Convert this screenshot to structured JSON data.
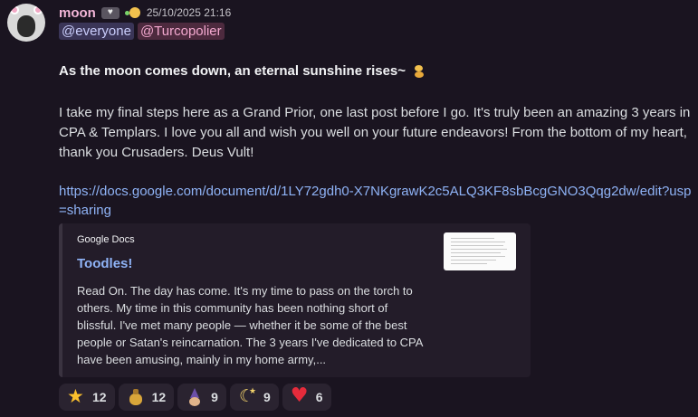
{
  "message": {
    "username": "moon",
    "timestamp": "25/10/2025 21:16",
    "mentions": [
      "@everyone",
      "@Turcopolier"
    ],
    "headline": "As the moon comes down, an eternal sunshine rises~",
    "body": "I take my final steps here as a Grand Prior, one last post before I go. It's truly been an amazing 3 years in CPA & Templars. I love you all and wish you well on your future endeavors! From the bottom of my heart, thank you Crusaders. Deus Vult!",
    "link": "https://docs.google.com/document/d/1LY72gdh0-X7NKgrawK2c5ALQ3KF8sbBcgGNO3Qqg2dw/edit?usp=sharing"
  },
  "embed": {
    "provider": "Google Docs",
    "title": "Toodles!",
    "description": "Read On. The day has come. It's my time to pass on the torch to others. My time in this community has been nothing short of blissful. I've met many people — whether it be some of the best people or Satan's reincarnation. The 3 years I've dedicated to CPA have been amusing, mainly in my home army,..."
  },
  "reactions": [
    {
      "icon": "star-icon",
      "count": "12"
    },
    {
      "icon": "moneybag-icon",
      "count": "12"
    },
    {
      "icon": "wizard-icon",
      "count": "9"
    },
    {
      "icon": "moon-icon",
      "count": "9"
    },
    {
      "icon": "heart-icon",
      "count": "6"
    }
  ],
  "colors": {
    "background": "#1a1420",
    "username": "#f3b6d8",
    "link": "#8fb3f6",
    "everyone_mention_bg": "#3a3557",
    "role_mention_bg": "#4d2a3e"
  }
}
